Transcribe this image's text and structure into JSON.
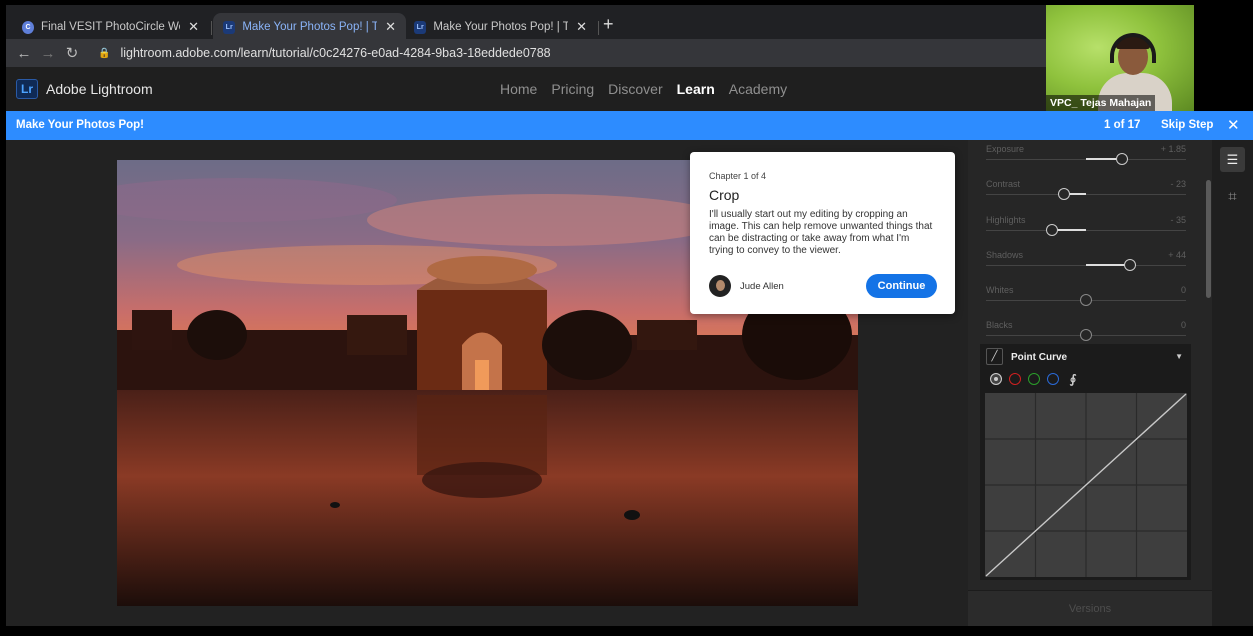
{
  "browser": {
    "tabs": [
      {
        "title": "Final VESIT PhotoCircle Worksho",
        "favicon": "chrome-icon",
        "active": false
      },
      {
        "title": "Make Your Photos Pop! | Tutorial",
        "favicon": "lightroom-icon",
        "active": true
      },
      {
        "title": "Make Your Photos Pop! | Tutorial",
        "favicon": "lightroom-icon",
        "active": false
      }
    ],
    "new_tab_label": "+",
    "url": "lightroom.adobe.com/learn/tutorial/c0c24276-e0ad-4284-9ba3-18eddede0788"
  },
  "header": {
    "logo_text": "Lr",
    "app_name": "Adobe Lightroom",
    "nav": [
      "Home",
      "Pricing",
      "Discover",
      "Learn",
      "Academy"
    ],
    "active_nav": "Learn"
  },
  "webcam": {
    "name": "VPC_ Tejas Mahajan"
  },
  "tutorial_bar": {
    "title": "Make Your Photos Pop!",
    "step": "1 of 17",
    "skip_label": "Skip Step",
    "close": "✕",
    "color": "#2d8cff"
  },
  "card": {
    "chapter": "Chapter 1 of 4",
    "title": "Crop",
    "body": "I'll usually start out my editing by cropping an image. This can help remove unwanted things that can be distracting or take away from what I'm trying to convey to the viewer.",
    "author": "Jude Allen",
    "continue_label": "Continue",
    "accent": "#1473e6"
  },
  "sliders": [
    {
      "label": "Exposure",
      "value": "+ 1.85",
      "position": 0.68
    },
    {
      "label": "Contrast",
      "value": "- 23",
      "position": 0.39
    },
    {
      "label": "Highlights",
      "value": "- 35",
      "position": 0.33
    },
    {
      "label": "Shadows",
      "value": "+ 44",
      "position": 0.72
    },
    {
      "label": "Whites",
      "value": "0",
      "position": 0.5
    },
    {
      "label": "Blacks",
      "value": "0",
      "position": 0.5
    }
  ],
  "point_curve": {
    "title": "Point Curve",
    "channels": [
      "white-channel",
      "red-channel",
      "green-channel",
      "blue-channel",
      "target-adjust-icon"
    ]
  },
  "versions_label": "Versions",
  "tools": [
    "edit-sliders-icon",
    "crop-icon"
  ]
}
